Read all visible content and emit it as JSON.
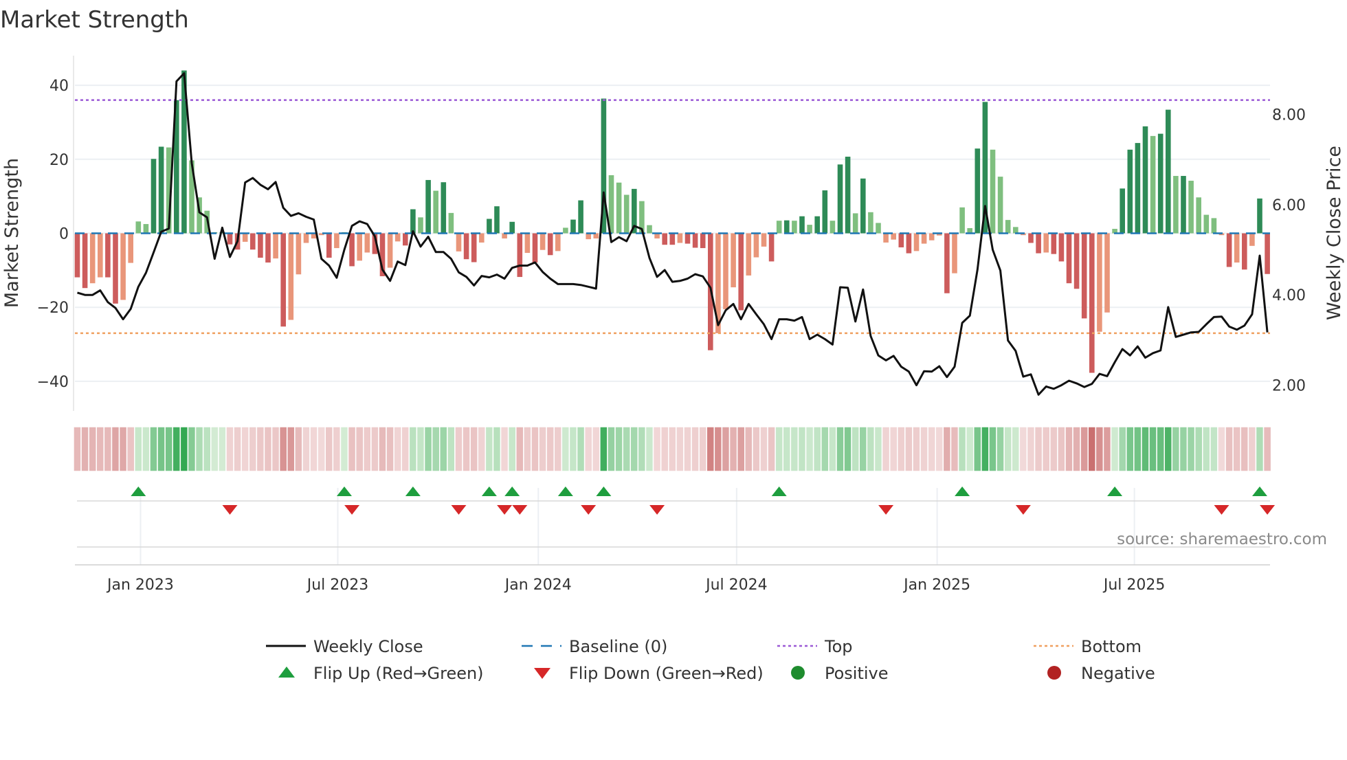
{
  "chart_data": {
    "type": "bar",
    "title": "Market Strength",
    "ylabel": "Market Strength",
    "y2label": "Weekly Close Price",
    "source": "source: sharemaestro.com",
    "x_start": "2022-11-04",
    "x_step_days": 7,
    "ylim": [
      -48,
      48
    ],
    "y2lim": [
      1.43,
      9.3
    ],
    "yticks": [
      -40,
      -20,
      0,
      20,
      40
    ],
    "ytick_labels": [
      "−40",
      "−20",
      "0",
      "20",
      "40"
    ],
    "y2ticks": [
      2,
      4,
      6,
      8
    ],
    "y2tick_labels": [
      "2.00",
      "4.00",
      "6.00",
      "8.00"
    ],
    "xticks": [
      {
        "date": "2023-01-01",
        "label": "Jan 2023"
      },
      {
        "date": "2023-07-01",
        "label": "Jul 2023"
      },
      {
        "date": "2024-01-01",
        "label": "Jan 2024"
      },
      {
        "date": "2024-07-01",
        "label": "Jul 2024"
      },
      {
        "date": "2025-01-01",
        "label": "Jan 2025"
      },
      {
        "date": "2025-07-01",
        "label": "Jul 2025"
      }
    ],
    "top_level": 36,
    "bottom_level": -27,
    "baseline": 0,
    "colors": {
      "pos_strong": "#2e8b57",
      "pos_weak": "#7fbf7f",
      "neg_strong": "#cd5c5c",
      "neg_weak": "#e9967a",
      "close": "#111111",
      "baseline": "#1f77b4",
      "top": "#9b59d6",
      "bottom": "#f0a060",
      "flip_up": "#1e9e3e",
      "flip_down": "#d62728",
      "positive": "#1e8c2e",
      "negative": "#b22222"
    },
    "strength": [
      -11.9,
      -14.8,
      -13.5,
      -11.9,
      -11.9,
      -19,
      -18,
      -8,
      3.2,
      2.5,
      20.1,
      23.4,
      23.2,
      36,
      44,
      19.7,
      9.7,
      6.1,
      0.3,
      0.3,
      -3,
      -4.4,
      -2.3,
      -4.4,
      -6.6,
      -7.9,
      -6.8,
      -25.2,
      -23.4,
      -11.1,
      -2.6,
      -1.4,
      -0.5,
      -6.6,
      -4,
      0.3,
      -8.9,
      -7.4,
      -5.2,
      -5.6,
      -11.6,
      -9.3,
      -2.2,
      -3.3,
      6.5,
      4.3,
      14.4,
      11.5,
      13.8,
      5.5,
      -4.9,
      -7,
      -7.8,
      -2.5,
      3.9,
      7.3,
      -1.4,
      3.1,
      -11.8,
      -5.3,
      -7.9,
      -4.5,
      -5.9,
      -4.8,
      1.5,
      3.7,
      8.9,
      -1.6,
      -1.4,
      36.4,
      15.7,
      13.7,
      10.4,
      12,
      8.7,
      2.2,
      -1.4,
      -3.1,
      -3.1,
      -2.6,
      -2.8,
      -3.9,
      -4,
      -31.6,
      -27,
      -20.5,
      -14.6,
      -20.8,
      -11.4,
      -6.5,
      -3.6,
      -7.6,
      3.4,
      3.5,
      3.4,
      4.6,
      2.3,
      4.6,
      11.6,
      3.4,
      18.6,
      20.7,
      5.4,
      14.8,
      5.7,
      2.8,
      -2.5,
      -1.7,
      -3.8,
      -5.4,
      -4.8,
      -2.8,
      -1.9,
      -0.6,
      -16.2,
      -10.8,
      7,
      1.4,
      22.9,
      35.5,
      22.6,
      15.3,
      3.6,
      1.7,
      -0.5,
      -2.6,
      -5.4,
      -5.2,
      -5.6,
      -7.6,
      -13.5,
      -15,
      -23,
      -37.7,
      -26.6,
      -21.4,
      1.2,
      12.1,
      22.6,
      24.4,
      28.9,
      26.3,
      26.9,
      33.4,
      15.5,
      15.5,
      14.2,
      9.7,
      5,
      4.1,
      -0.5,
      -9.1,
      -7.9,
      -9.8,
      -3.4,
      9.4,
      -11
    ],
    "close": [
      4.05,
      4.0,
      4.0,
      4.1,
      3.84,
      3.71,
      3.46,
      3.69,
      4.18,
      4.49,
      4.94,
      5.4,
      5.47,
      8.73,
      8.91,
      6.92,
      5.83,
      5.72,
      4.8,
      5.49,
      4.84,
      5.19,
      6.49,
      6.59,
      6.44,
      6.34,
      6.5,
      5.93,
      5.75,
      5.81,
      5.73,
      5.67,
      4.8,
      4.65,
      4.38,
      5.0,
      5.53,
      5.63,
      5.57,
      5.3,
      4.56,
      4.31,
      4.74,
      4.66,
      5.41,
      5.07,
      5.29,
      4.95,
      4.95,
      4.8,
      4.5,
      4.4,
      4.21,
      4.42,
      4.39,
      4.45,
      4.36,
      4.6,
      4.65,
      4.65,
      4.72,
      4.51,
      4.36,
      4.24,
      4.24,
      4.24,
      4.22,
      4.18,
      4.14,
      6.27,
      5.17,
      5.28,
      5.19,
      5.53,
      5.46,
      4.82,
      4.4,
      4.55,
      4.29,
      4.31,
      4.36,
      4.46,
      4.41,
      4.16,
      3.33,
      3.66,
      3.8,
      3.46,
      3.8,
      3.57,
      3.35,
      3.02,
      3.46,
      3.46,
      3.43,
      3.51,
      3.02,
      3.12,
      3.02,
      2.9,
      4.17,
      4.16,
      3.41,
      4.12,
      3.09,
      2.66,
      2.55,
      2.65,
      2.41,
      2.3,
      2.0,
      2.31,
      2.3,
      2.42,
      2.18,
      2.41,
      3.38,
      3.54,
      4.56,
      5.97,
      5.0,
      4.54,
      2.99,
      2.76,
      2.19,
      2.24,
      1.79,
      1.97,
      1.92,
      2.0,
      2.1,
      2.04,
      1.96,
      2.03,
      2.25,
      2.2,
      2.51,
      2.8,
      2.66,
      2.86,
      2.61,
      2.71,
      2.77,
      3.73,
      3.07,
      3.12,
      3.17,
      3.18,
      3.35,
      3.51,
      3.52,
      3.3,
      3.23,
      3.32,
      3.57,
      4.87,
      3.17
    ],
    "flip_up_weeks": [
      8,
      35,
      44,
      54,
      57,
      64,
      69,
      92,
      116,
      136,
      155
    ],
    "flip_down_weeks": [
      20,
      36,
      50,
      56,
      58,
      67,
      76,
      106,
      124,
      150,
      156
    ],
    "legend": [
      {
        "key": "close",
        "label": "Weekly Close"
      },
      {
        "key": "baseline",
        "label": "Baseline (0)"
      },
      {
        "key": "top",
        "label": "Top"
      },
      {
        "key": "bottom",
        "label": "Bottom"
      },
      {
        "key": "flip_up",
        "label": "Flip Up (Red→Green)"
      },
      {
        "key": "flip_down",
        "label": "Flip Down (Green→Red)"
      },
      {
        "key": "positive",
        "label": "Positive"
      },
      {
        "key": "negative",
        "label": "Negative"
      }
    ],
    "legend_position": "bottom"
  }
}
